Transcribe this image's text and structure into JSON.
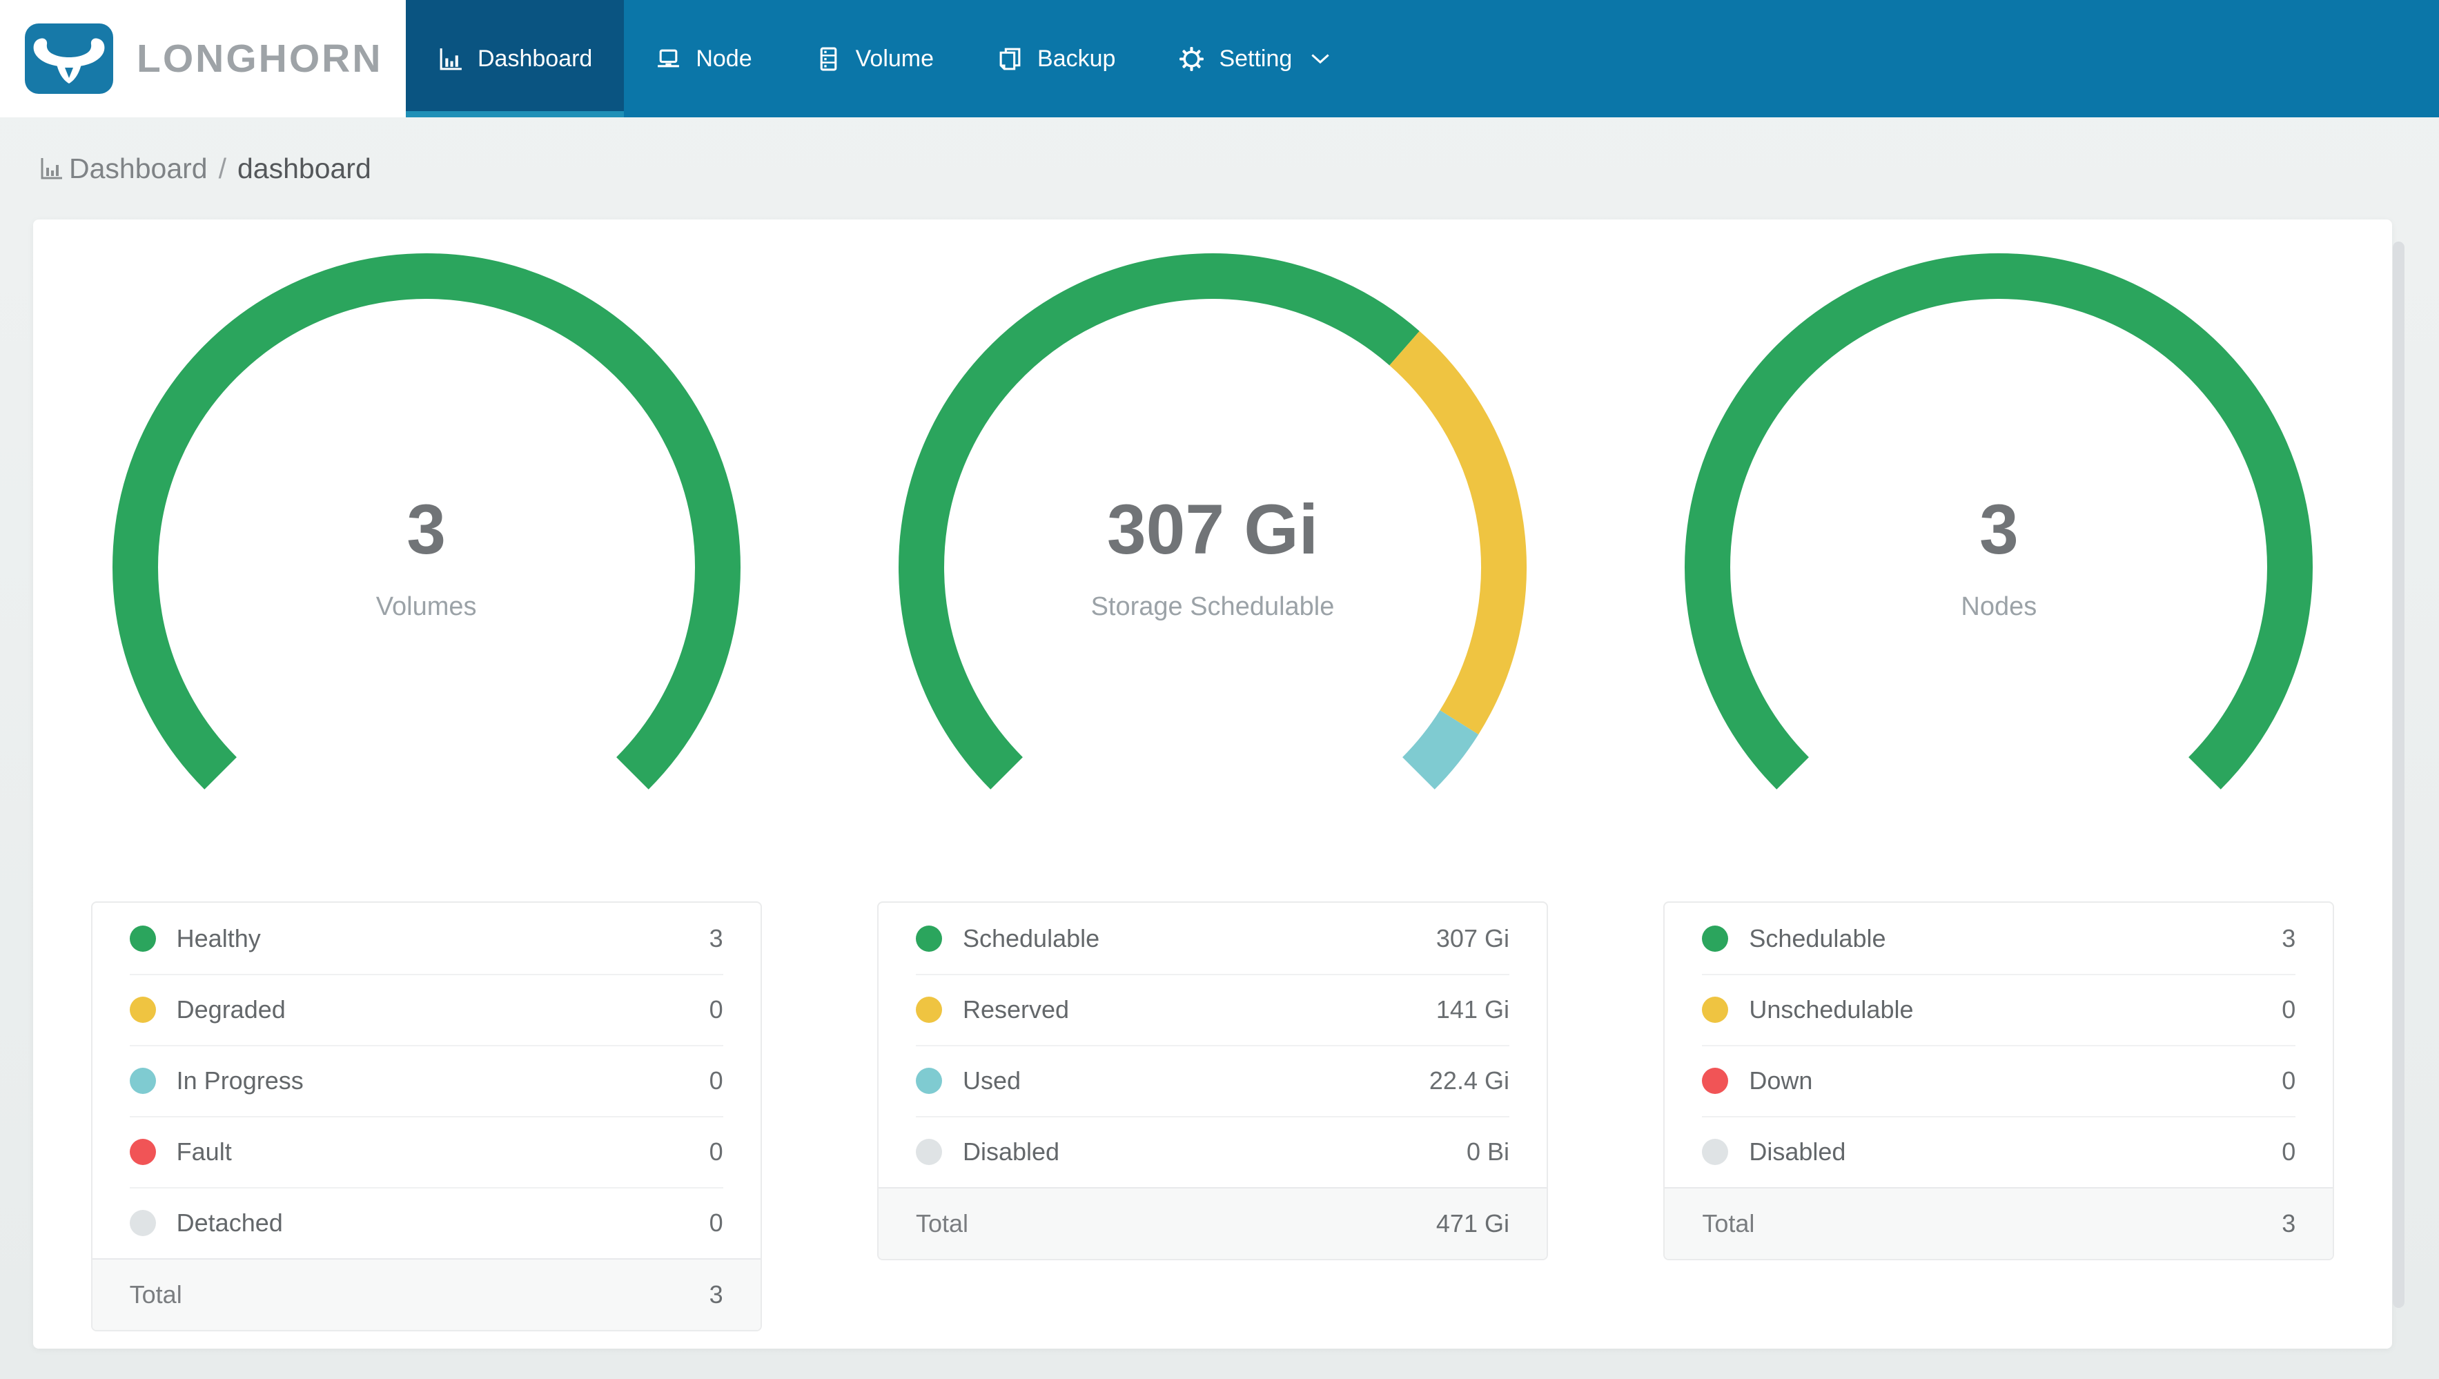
{
  "brand": {
    "name": "LONGHORN"
  },
  "nav": {
    "items": [
      {
        "label": "Dashboard",
        "icon": "bar-chart-icon",
        "active": true
      },
      {
        "label": "Node",
        "icon": "laptop-icon",
        "active": false
      },
      {
        "label": "Volume",
        "icon": "database-icon",
        "active": false
      },
      {
        "label": "Backup",
        "icon": "copy-icon",
        "active": false
      },
      {
        "label": "Setting",
        "icon": "gear-icon",
        "active": false,
        "has_dropdown": true
      }
    ]
  },
  "breadcrumb": {
    "section": "Dashboard",
    "separator": "/",
    "page": "dashboard"
  },
  "colors": {
    "nav_bg": "#0B76A8",
    "nav_active_bg": "#0A5481",
    "nav_active_underline": "#2090B7",
    "brand_blue": "#1779A8",
    "page_bg": "#ECEFEF",
    "healthy_green": "#2BA55D",
    "warning_yellow": "#EFC441",
    "info_teal": "#7FCBD1",
    "danger_red": "#F15456",
    "disabled_gray": "#DFE3E5"
  },
  "chart_data": [
    {
      "type": "gauge",
      "center_value": "3",
      "center_label": "Volumes",
      "start_angle": 225,
      "end_angle": -45,
      "segments": [
        {
          "label": "Healthy",
          "value": 3,
          "display": "3",
          "color": "#2BA55D"
        },
        {
          "label": "Degraded",
          "value": 0,
          "display": "0",
          "color": "#EFC441"
        },
        {
          "label": "In Progress",
          "value": 0,
          "display": "0",
          "color": "#7FCBD1"
        },
        {
          "label": "Fault",
          "value": 0,
          "display": "0",
          "color": "#F15456"
        },
        {
          "label": "Detached",
          "value": 0,
          "display": "0",
          "color": "#DFE3E5"
        }
      ],
      "total": {
        "label": "Total",
        "display": "3"
      }
    },
    {
      "type": "gauge",
      "center_value": "307 Gi",
      "center_label": "Storage Schedulable",
      "start_angle": 225,
      "end_angle": -45,
      "segments": [
        {
          "label": "Schedulable",
          "value": 307,
          "display": "307 Gi",
          "color": "#2BA55D"
        },
        {
          "label": "Reserved",
          "value": 141,
          "display": "141 Gi",
          "color": "#EFC441"
        },
        {
          "label": "Used",
          "value": 22.4,
          "display": "22.4 Gi",
          "color": "#7FCBD1"
        },
        {
          "label": "Disabled",
          "value": 0,
          "display": "0 Bi",
          "color": "#DFE3E5"
        }
      ],
      "total": {
        "label": "Total",
        "display": "471 Gi"
      }
    },
    {
      "type": "gauge",
      "center_value": "3",
      "center_label": "Nodes",
      "start_angle": 225,
      "end_angle": -45,
      "segments": [
        {
          "label": "Schedulable",
          "value": 3,
          "display": "3",
          "color": "#2BA55D"
        },
        {
          "label": "Unschedulable",
          "value": 0,
          "display": "0",
          "color": "#EFC441"
        },
        {
          "label": "Down",
          "value": 0,
          "display": "0",
          "color": "#F15456"
        },
        {
          "label": "Disabled",
          "value": 0,
          "display": "0",
          "color": "#DFE3E5"
        }
      ],
      "total": {
        "label": "Total",
        "display": "3"
      }
    }
  ]
}
